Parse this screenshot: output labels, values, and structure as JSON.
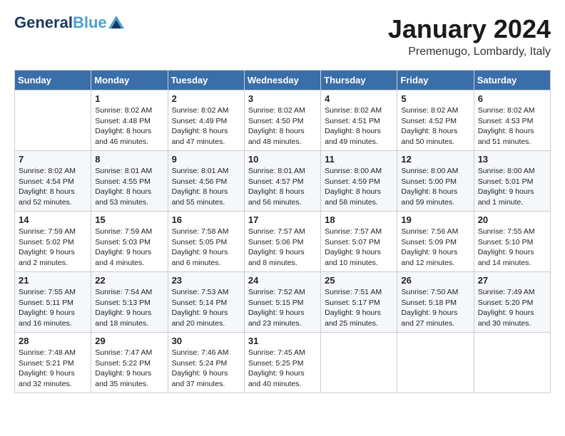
{
  "header": {
    "logo_line1": "General",
    "logo_line2": "Blue",
    "month": "January 2024",
    "location": "Premenugo, Lombardy, Italy"
  },
  "weekdays": [
    "Sunday",
    "Monday",
    "Tuesday",
    "Wednesday",
    "Thursday",
    "Friday",
    "Saturday"
  ],
  "weeks": [
    [
      {
        "day": "",
        "sunrise": "",
        "sunset": "",
        "daylight": ""
      },
      {
        "day": "1",
        "sunrise": "Sunrise: 8:02 AM",
        "sunset": "Sunset: 4:48 PM",
        "daylight": "Daylight: 8 hours and 46 minutes."
      },
      {
        "day": "2",
        "sunrise": "Sunrise: 8:02 AM",
        "sunset": "Sunset: 4:49 PM",
        "daylight": "Daylight: 8 hours and 47 minutes."
      },
      {
        "day": "3",
        "sunrise": "Sunrise: 8:02 AM",
        "sunset": "Sunset: 4:50 PM",
        "daylight": "Daylight: 8 hours and 48 minutes."
      },
      {
        "day": "4",
        "sunrise": "Sunrise: 8:02 AM",
        "sunset": "Sunset: 4:51 PM",
        "daylight": "Daylight: 8 hours and 49 minutes."
      },
      {
        "day": "5",
        "sunrise": "Sunrise: 8:02 AM",
        "sunset": "Sunset: 4:52 PM",
        "daylight": "Daylight: 8 hours and 50 minutes."
      },
      {
        "day": "6",
        "sunrise": "Sunrise: 8:02 AM",
        "sunset": "Sunset: 4:53 PM",
        "daylight": "Daylight: 8 hours and 51 minutes."
      }
    ],
    [
      {
        "day": "7",
        "sunrise": "Sunrise: 8:02 AM",
        "sunset": "Sunset: 4:54 PM",
        "daylight": "Daylight: 8 hours and 52 minutes."
      },
      {
        "day": "8",
        "sunrise": "Sunrise: 8:01 AM",
        "sunset": "Sunset: 4:55 PM",
        "daylight": "Daylight: 8 hours and 53 minutes."
      },
      {
        "day": "9",
        "sunrise": "Sunrise: 8:01 AM",
        "sunset": "Sunset: 4:56 PM",
        "daylight": "Daylight: 8 hours and 55 minutes."
      },
      {
        "day": "10",
        "sunrise": "Sunrise: 8:01 AM",
        "sunset": "Sunset: 4:57 PM",
        "daylight": "Daylight: 8 hours and 56 minutes."
      },
      {
        "day": "11",
        "sunrise": "Sunrise: 8:00 AM",
        "sunset": "Sunset: 4:59 PM",
        "daylight": "Daylight: 8 hours and 58 minutes."
      },
      {
        "day": "12",
        "sunrise": "Sunrise: 8:00 AM",
        "sunset": "Sunset: 5:00 PM",
        "daylight": "Daylight: 8 hours and 59 minutes."
      },
      {
        "day": "13",
        "sunrise": "Sunrise: 8:00 AM",
        "sunset": "Sunset: 5:01 PM",
        "daylight": "Daylight: 9 hours and 1 minute."
      }
    ],
    [
      {
        "day": "14",
        "sunrise": "Sunrise: 7:59 AM",
        "sunset": "Sunset: 5:02 PM",
        "daylight": "Daylight: 9 hours and 2 minutes."
      },
      {
        "day": "15",
        "sunrise": "Sunrise: 7:59 AM",
        "sunset": "Sunset: 5:03 PM",
        "daylight": "Daylight: 9 hours and 4 minutes."
      },
      {
        "day": "16",
        "sunrise": "Sunrise: 7:58 AM",
        "sunset": "Sunset: 5:05 PM",
        "daylight": "Daylight: 9 hours and 6 minutes."
      },
      {
        "day": "17",
        "sunrise": "Sunrise: 7:57 AM",
        "sunset": "Sunset: 5:06 PM",
        "daylight": "Daylight: 9 hours and 8 minutes."
      },
      {
        "day": "18",
        "sunrise": "Sunrise: 7:57 AM",
        "sunset": "Sunset: 5:07 PM",
        "daylight": "Daylight: 9 hours and 10 minutes."
      },
      {
        "day": "19",
        "sunrise": "Sunrise: 7:56 AM",
        "sunset": "Sunset: 5:09 PM",
        "daylight": "Daylight: 9 hours and 12 minutes."
      },
      {
        "day": "20",
        "sunrise": "Sunrise: 7:55 AM",
        "sunset": "Sunset: 5:10 PM",
        "daylight": "Daylight: 9 hours and 14 minutes."
      }
    ],
    [
      {
        "day": "21",
        "sunrise": "Sunrise: 7:55 AM",
        "sunset": "Sunset: 5:11 PM",
        "daylight": "Daylight: 9 hours and 16 minutes."
      },
      {
        "day": "22",
        "sunrise": "Sunrise: 7:54 AM",
        "sunset": "Sunset: 5:13 PM",
        "daylight": "Daylight: 9 hours and 18 minutes."
      },
      {
        "day": "23",
        "sunrise": "Sunrise: 7:53 AM",
        "sunset": "Sunset: 5:14 PM",
        "daylight": "Daylight: 9 hours and 20 minutes."
      },
      {
        "day": "24",
        "sunrise": "Sunrise: 7:52 AM",
        "sunset": "Sunset: 5:15 PM",
        "daylight": "Daylight: 9 hours and 23 minutes."
      },
      {
        "day": "25",
        "sunrise": "Sunrise: 7:51 AM",
        "sunset": "Sunset: 5:17 PM",
        "daylight": "Daylight: 9 hours and 25 minutes."
      },
      {
        "day": "26",
        "sunrise": "Sunrise: 7:50 AM",
        "sunset": "Sunset: 5:18 PM",
        "daylight": "Daylight: 9 hours and 27 minutes."
      },
      {
        "day": "27",
        "sunrise": "Sunrise: 7:49 AM",
        "sunset": "Sunset: 5:20 PM",
        "daylight": "Daylight: 9 hours and 30 minutes."
      }
    ],
    [
      {
        "day": "28",
        "sunrise": "Sunrise: 7:48 AM",
        "sunset": "Sunset: 5:21 PM",
        "daylight": "Daylight: 9 hours and 32 minutes."
      },
      {
        "day": "29",
        "sunrise": "Sunrise: 7:47 AM",
        "sunset": "Sunset: 5:22 PM",
        "daylight": "Daylight: 9 hours and 35 minutes."
      },
      {
        "day": "30",
        "sunrise": "Sunrise: 7:46 AM",
        "sunset": "Sunset: 5:24 PM",
        "daylight": "Daylight: 9 hours and 37 minutes."
      },
      {
        "day": "31",
        "sunrise": "Sunrise: 7:45 AM",
        "sunset": "Sunset: 5:25 PM",
        "daylight": "Daylight: 9 hours and 40 minutes."
      },
      {
        "day": "",
        "sunrise": "",
        "sunset": "",
        "daylight": ""
      },
      {
        "day": "",
        "sunrise": "",
        "sunset": "",
        "daylight": ""
      },
      {
        "day": "",
        "sunrise": "",
        "sunset": "",
        "daylight": ""
      }
    ]
  ]
}
